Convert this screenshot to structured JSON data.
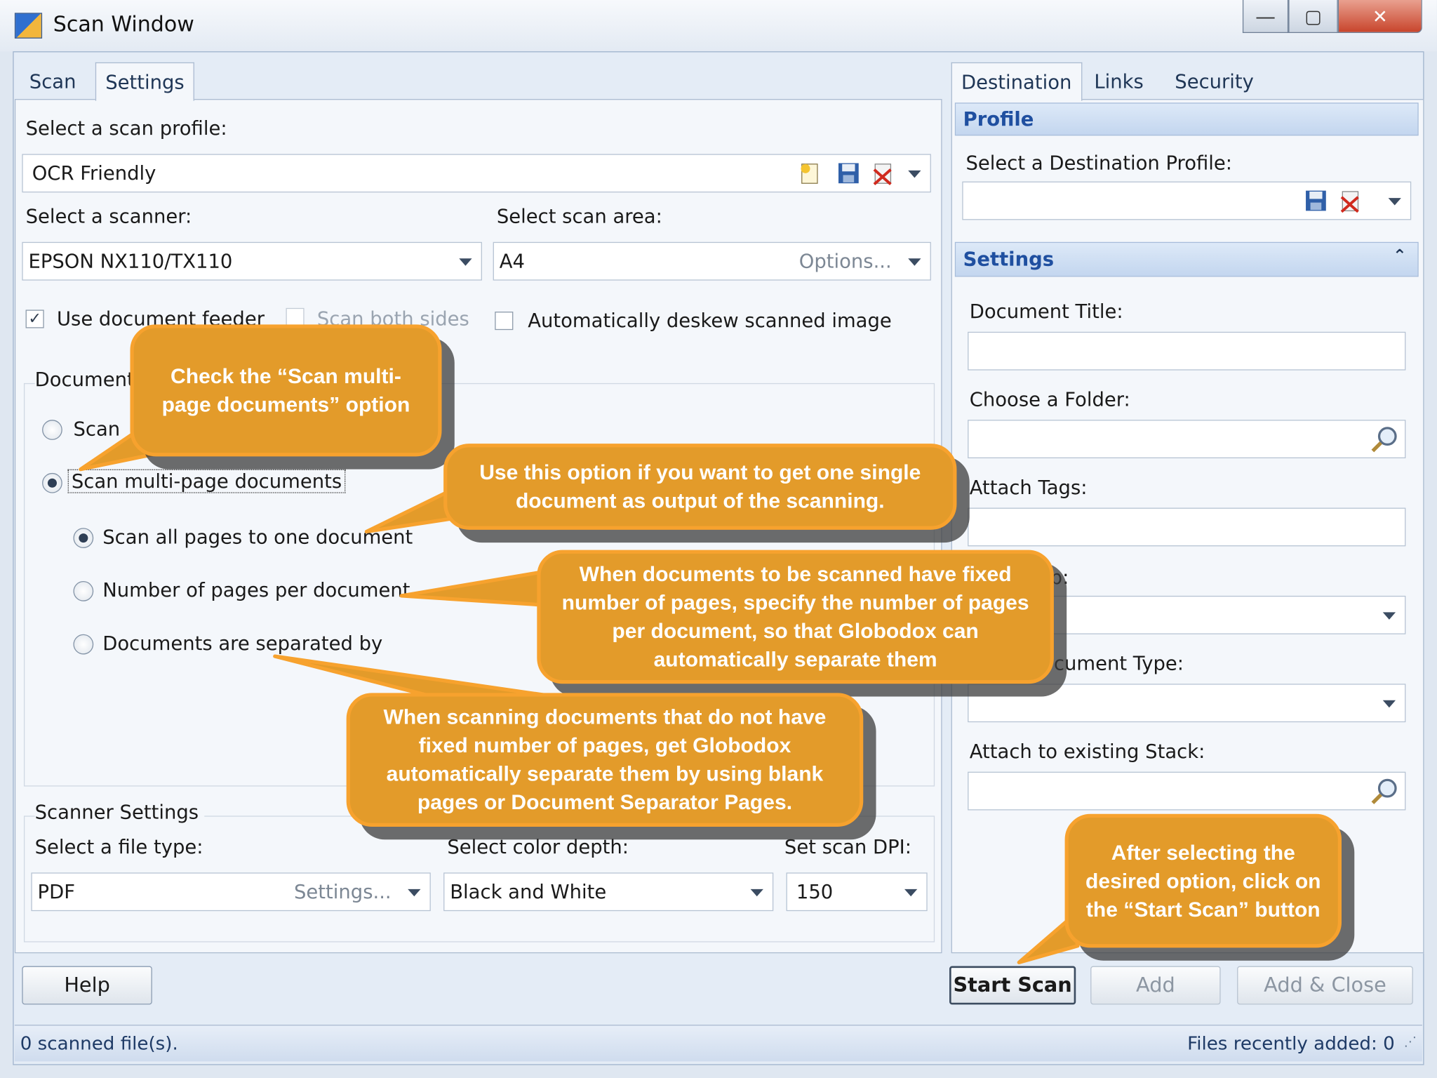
{
  "window": {
    "title": "Scan Window"
  },
  "left_tabs": [
    "Scan",
    "Settings"
  ],
  "scan_profile": {
    "label": "Select a scan profile:",
    "value": "OCR Friendly"
  },
  "scanner": {
    "label": "Select a scanner:",
    "value": "EPSON NX110/TX110"
  },
  "scan_area": {
    "label": "Select scan area:",
    "value": "A4",
    "options_label": "Options..."
  },
  "checkboxes": {
    "use_feeder": {
      "label": "Use document feeder",
      "checked": true
    },
    "both_sides": {
      "label": "Scan both sides",
      "checked": false
    },
    "deskew": {
      "label": "Automatically deskew scanned image",
      "checked": false
    }
  },
  "document_group": {
    "label": "Document",
    "radio_single_partial": "Scan",
    "radio_multi": "Scan multi-page documents",
    "sub_all_pages": "Scan all pages to one document",
    "sub_pages_per_doc": "Number of pages per document",
    "sub_separated_by": "Documents are separated by"
  },
  "scanner_settings": {
    "label": "Scanner Settings",
    "file_type_label": "Select a file type:",
    "file_type_value": "PDF",
    "file_type_settings": "Settings...",
    "color_depth_label": "Select color depth:",
    "color_depth_value": "Black and White",
    "dpi_label": "Set scan DPI:",
    "dpi_value": "150"
  },
  "right_tabs": [
    "Destination",
    "Links",
    "Security"
  ],
  "profile_section": {
    "header": "Profile",
    "label": "Select a Destination Profile:"
  },
  "settings_section": {
    "header": "Settings",
    "doc_title_label": "Document Title:",
    "folder_label": "Choose a Folder:",
    "tags_label": "Attach Tags:",
    "partial_label_1": "p:",
    "partial_label_2": "cument Type:",
    "stack_label": "Attach to existing Stack:"
  },
  "buttons": {
    "help": "Help",
    "start_scan": "Start Scan",
    "add": "Add",
    "add_close": "Add & Close"
  },
  "status": {
    "left": "0 scanned file(s).",
    "right": "Files recently added: 0"
  },
  "callouts": {
    "c1": "Check the “Scan multi-page documents” option",
    "c2": "Use this option if you want to get one single document as output of the scanning.",
    "c3": "When documents to be scanned have fixed number of pages, specify the number of pages per document, so that Globodox can automatically  separate them",
    "c4": "When scanning documents that do not have fixed number of pages, get Globodox automatically separate them by using blank pages or Document Separator Pages.",
    "c5": "After selecting the desired option, click on the “Start Scan” button"
  },
  "colors": {
    "callout_fill": "#e39b2a",
    "callout_border": "#f7a22e",
    "header_text": "#1f4fa0"
  }
}
